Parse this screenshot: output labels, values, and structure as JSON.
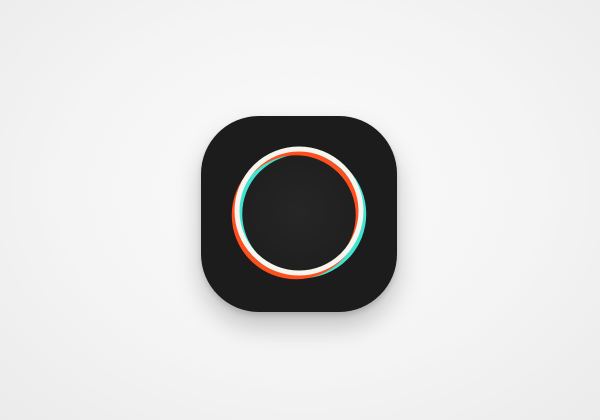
{
  "icon": {
    "name": "circular-ring-app-icon",
    "colors": {
      "tile": "#1c1c1c",
      "inner_disc": "#222222",
      "ring_white": "#f7f5ee",
      "ring_orange": "#ff4f1f",
      "ring_cyan": "#3fe3d0",
      "background": "#f2f2f2"
    }
  }
}
